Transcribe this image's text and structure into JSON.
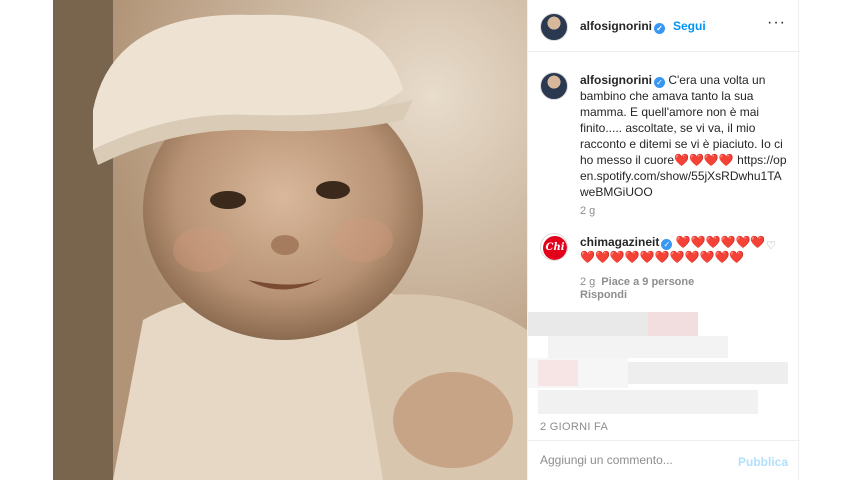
{
  "post_header": {
    "username": "alfosignorini",
    "separator": "•",
    "follow_label": "Segui",
    "more_label": "···"
  },
  "caption": {
    "username": "alfosignorini",
    "text": "C'era una volta un bambino che amava tanto la sua mamma. E quell'amore non è mai finito..... ascoltate, se vi va, il mio racconto e ditemi se vi è piaciuto. Io ci ho messo il cuore",
    "hearts": "❤️❤️❤️❤️",
    "link": "https://open.spotify.com/show/55jXsRDwhu1TAweBMGiUOO",
    "time": "2 g"
  },
  "comment": {
    "avatar_label": "Chi",
    "username": "chimagazineit",
    "hearts_line": "❤️❤️❤️❤️❤️❤️❤️❤️❤️❤️❤️❤️❤️❤️❤️❤️❤️",
    "time": "2 g",
    "likes": "Piace a 9 persone",
    "reply_label": "Rispondi",
    "like_icon": "heart-outline-icon"
  },
  "post_time": "2 GIORNI FA",
  "add_comment": {
    "placeholder": "Aggiungi un commento...",
    "publish_label": "Pubblica"
  },
  "colors": {
    "link_blue": "#0095f6",
    "verified_blue": "#3897f0",
    "heart_red": "#e0151b",
    "publish_disabled": "#b2dffc",
    "chi_red": "#e2001a"
  }
}
